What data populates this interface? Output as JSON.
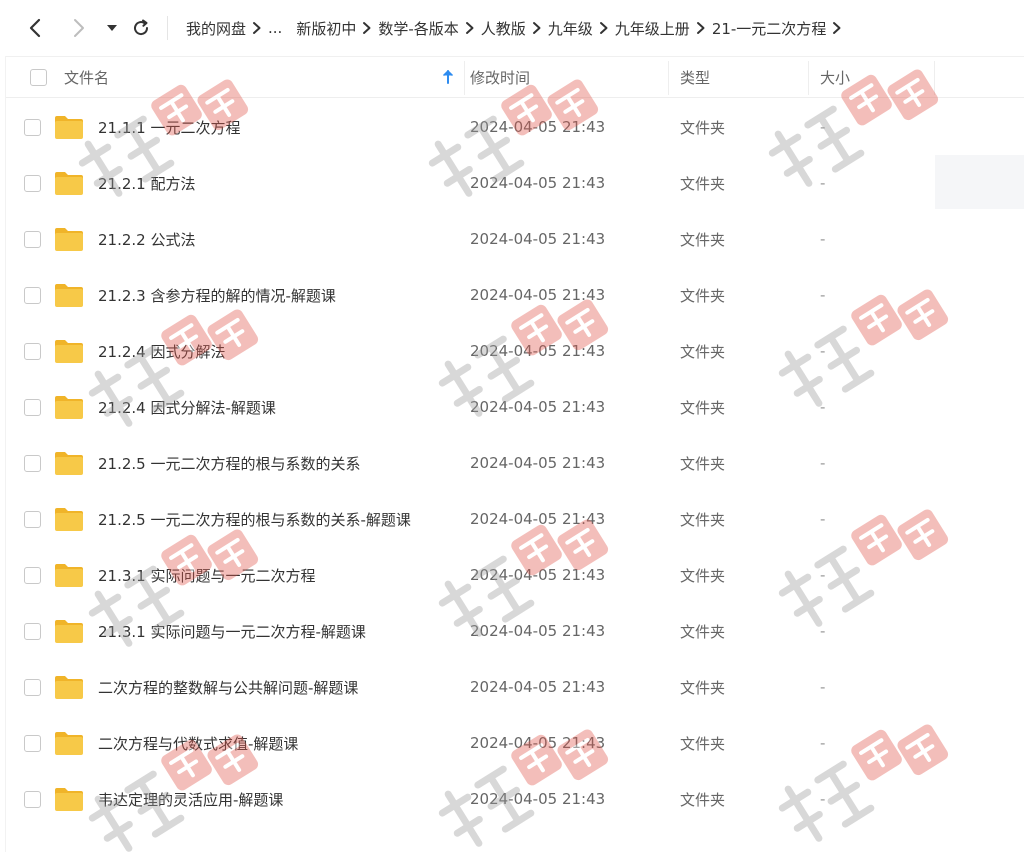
{
  "nav": {
    "breadcrumbs": [
      "我的网盘",
      "...",
      "新版初中",
      "数学-各版本",
      "人教版",
      "九年级",
      "九年级上册",
      "21-一元二次方程"
    ]
  },
  "columns": {
    "name": "文件名",
    "modified": "修改时间",
    "type": "类型",
    "size": "大小"
  },
  "files": [
    {
      "name": "21.1.1 一元二次方程",
      "modified": "2024-04-05 21:43",
      "type": "文件夹",
      "size": "-"
    },
    {
      "name": "21.2.1 配方法",
      "modified": "2024-04-05 21:43",
      "type": "文件夹",
      "size": "-"
    },
    {
      "name": "21.2.2 公式法",
      "modified": "2024-04-05 21:43",
      "type": "文件夹",
      "size": "-"
    },
    {
      "name": "21.2.3 含参方程的解的情况-解题课",
      "modified": "2024-04-05 21:43",
      "type": "文件夹",
      "size": "-"
    },
    {
      "name": "21.2.4 因式分解法",
      "modified": "2024-04-05 21:43",
      "type": "文件夹",
      "size": "-"
    },
    {
      "name": "21.2.4 因式分解法-解题课",
      "modified": "2024-04-05 21:43",
      "type": "文件夹",
      "size": "-"
    },
    {
      "name": "21.2.5 一元二次方程的根与系数的关系",
      "modified": "2024-04-05 21:43",
      "type": "文件夹",
      "size": "-"
    },
    {
      "name": "21.2.5 一元二次方程的根与系数的关系-解题课",
      "modified": "2024-04-05 21:43",
      "type": "文件夹",
      "size": "-"
    },
    {
      "name": "21.3.1 实际问题与一元二次方程",
      "modified": "2024-04-05 21:43",
      "type": "文件夹",
      "size": "-"
    },
    {
      "name": "21.3.1 实际问题与一元二次方程-解题课",
      "modified": "2024-04-05 21:43",
      "type": "文件夹",
      "size": "-"
    },
    {
      "name": "二次方程的整数解与公共解问题-解题课",
      "modified": "2024-04-05 21:43",
      "type": "文件夹",
      "size": "-"
    },
    {
      "name": "二次方程与代数式求值-解题课",
      "modified": "2024-04-05 21:43",
      "type": "文件夹",
      "size": "-"
    },
    {
      "name": "韦达定理的灵活应用-解题课",
      "modified": "2024-04-05 21:43",
      "type": "文件夹",
      "size": "-"
    }
  ],
  "colors": {
    "folder": "#f7c948",
    "folder_dark": "#f0b429",
    "sort_arrow": "#2e8cf0",
    "watermark_grey": "#9a9a9a",
    "watermark_red": "#e2574c"
  }
}
